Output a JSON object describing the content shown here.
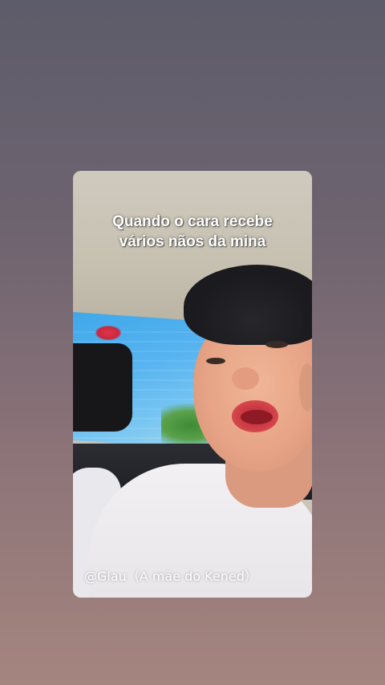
{
  "video": {
    "caption_line1": "Quando o cara recebe",
    "caption_line2": "vários nãos da mina",
    "watermark": "@Glau（A mãe do Kened）"
  },
  "colors": {
    "background_top": "#5d5c6a",
    "background_bottom": "#a5857f",
    "caption_text": "#ffffff"
  }
}
